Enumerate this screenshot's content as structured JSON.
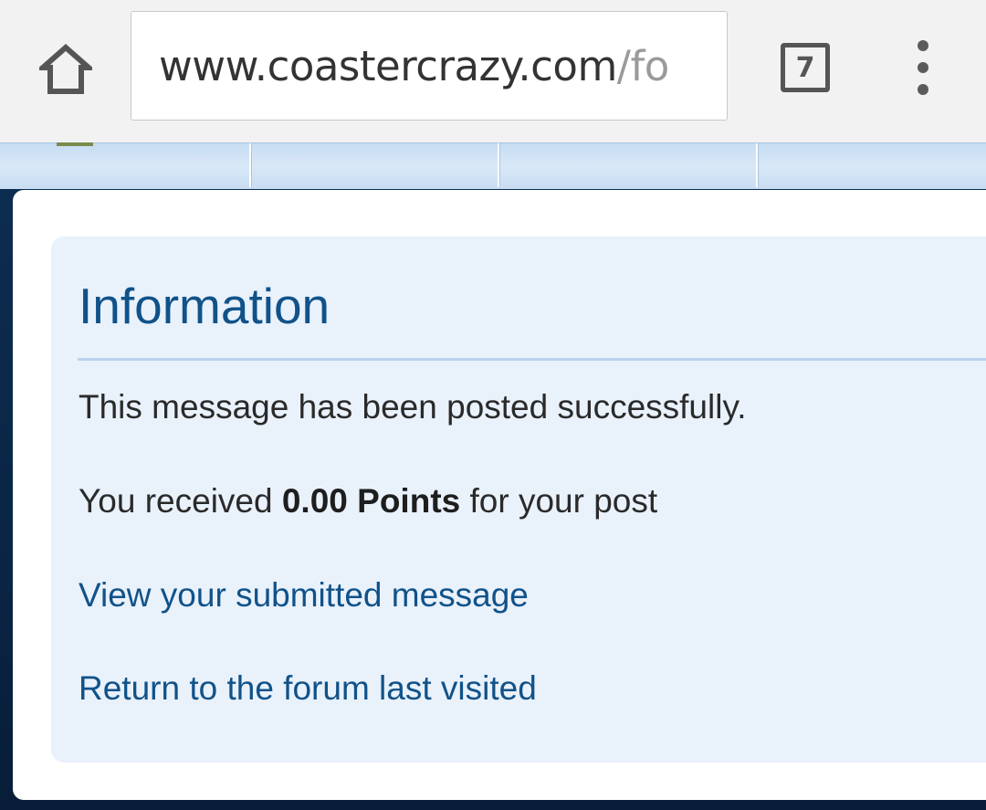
{
  "browser": {
    "url_host": "www.coastercrazy.com",
    "url_path": "/fo",
    "tab_count": "7",
    "icons": {
      "home": "home-icon",
      "tabs": "tab-switcher-icon",
      "menu": "overflow-menu-icon"
    }
  },
  "message_box": {
    "title": "Information",
    "success_text": "This message has been posted successfully.",
    "points_prefix": "You received ",
    "points_value": "0.00 Points",
    "points_suffix": " for your post",
    "view_link": "View your submitted message",
    "return_link": "Return to the forum last visited"
  },
  "colors": {
    "title": "#105289",
    "link": "#105289",
    "info_bg": "#e9f1fb",
    "page_bg": "#0d2d52"
  }
}
